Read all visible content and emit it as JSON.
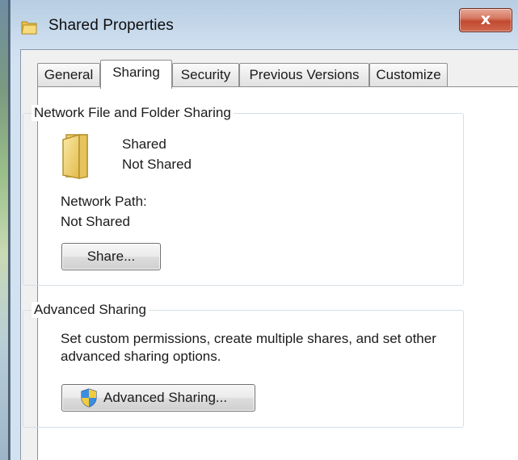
{
  "window": {
    "title": "Shared Properties",
    "close_label": "x"
  },
  "tabs": [
    {
      "label": "General",
      "selected": false
    },
    {
      "label": "Sharing",
      "selected": true
    },
    {
      "label": "Security",
      "selected": false
    },
    {
      "label": "Previous Versions",
      "selected": false
    },
    {
      "label": "Customize",
      "selected": false
    }
  ],
  "network_sharing": {
    "group_title": "Network File and Folder Sharing",
    "folder_name": "Shared",
    "share_status": "Not Shared",
    "path_label": "Network Path:",
    "path_value": "Not Shared",
    "share_button": "Share..."
  },
  "advanced_sharing": {
    "group_title": "Advanced Sharing",
    "description_line1": "Set custom permissions, create multiple shares, and set other",
    "description_line2": "advanced sharing options.",
    "button_label": "Advanced Sharing...",
    "button_icon": "uac-shield-icon"
  },
  "colors": {
    "title_bar": "#c5d8ea",
    "close_button": "#c14a31",
    "folder": "#f1d67a"
  }
}
